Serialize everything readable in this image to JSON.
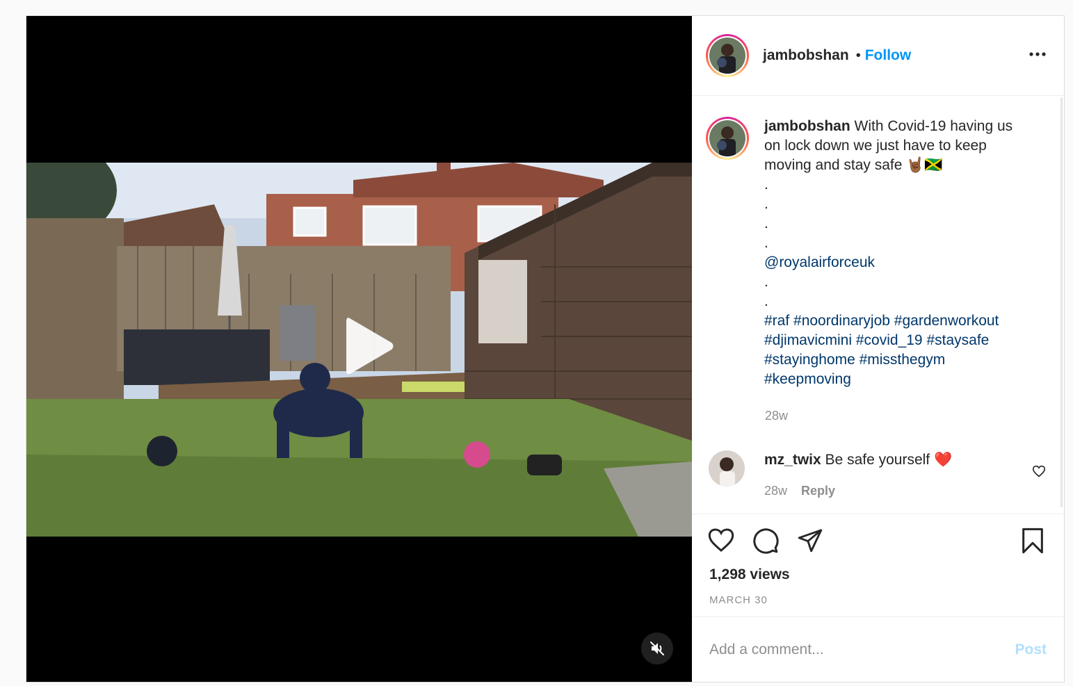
{
  "post": {
    "username": "jambobshan",
    "follow_label": "Follow",
    "separator": "•",
    "caption": {
      "username": "jambobshan",
      "text": "With Covid-19 having us on lock down we just have to keep moving and stay safe 🤘🏾🇯🇲",
      "dots": [
        ".",
        ".",
        ".",
        "."
      ],
      "mention": "@royalairforceuk",
      "dots2": [
        ".",
        "."
      ],
      "hashtags": "#raf #noordinaryjob #gardenworkout #djimavicmini #covid_19 #staysafe #stayinghome #missthegym #keepmoving",
      "time": "28w"
    },
    "comments": [
      {
        "username": "mz_twix",
        "text": "Be safe yourself ❤️",
        "time": "28w",
        "reply_label": "Reply"
      }
    ],
    "views": "1,298 views",
    "date": "MARCH 30",
    "add_comment_placeholder": "Add a comment...",
    "post_label": "Post"
  },
  "icons": {
    "play": "play-icon",
    "mute": "muted-speaker-icon",
    "more": "more-horizontal-icon",
    "like": "heart-icon",
    "comment": "comment-bubble-icon",
    "share": "paper-plane-icon",
    "save": "bookmark-icon"
  },
  "colors": {
    "link_blue": "#0095f6",
    "hashtag_blue": "#00376b",
    "secondary_text": "#8e8e8e",
    "post_button_disabled": "#b2dffc"
  }
}
